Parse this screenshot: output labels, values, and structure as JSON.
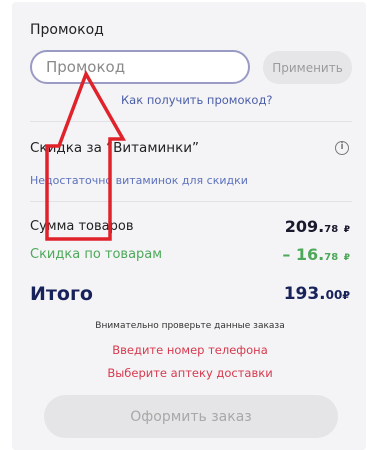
{
  "promo": {
    "title": "Промокод",
    "placeholder": "Промокод",
    "apply_label": "Применить",
    "help_link": "Как получить промокод?"
  },
  "discount_block": {
    "title": "Скидка за “Витаминки”",
    "note": "Недостаточно витаминок для скидки",
    "info_icon": "i"
  },
  "summary": {
    "items_label": "Сумма товаров",
    "items_whole": "209.",
    "items_cents": "78",
    "currency": "₽",
    "discount_label": "Скидка по товарам",
    "discount_whole": "– 16.",
    "discount_cents": "78",
    "total_label": "Итого",
    "total_whole": "193.",
    "total_cents": "00"
  },
  "notices": {
    "check": "Внимательно проверьте данные заказа",
    "phone": "Введите номер телефона",
    "pharmacy": "Выберите аптеку доставки"
  },
  "order": {
    "label": "Оформить заказ"
  },
  "colors": {
    "accent": "#18225a",
    "link": "#4b5ea8",
    "discount": "#4ea85a",
    "warning": "#d63a4e",
    "annotation_arrow": "#e0222b"
  }
}
